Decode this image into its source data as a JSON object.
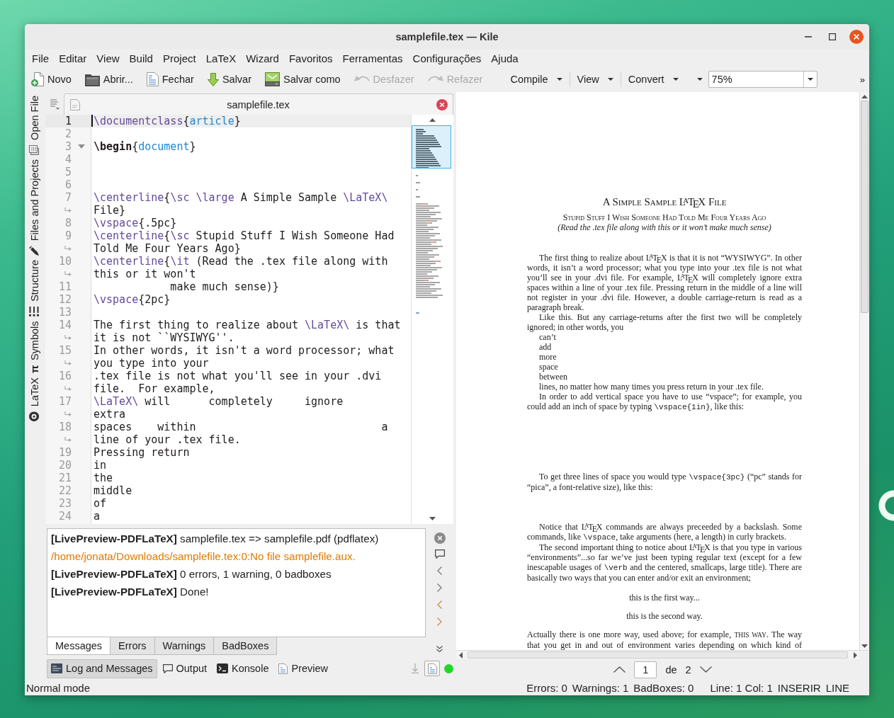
{
  "window": {
    "title": "samplefile.tex — Kile"
  },
  "menu": [
    "File",
    "Editar",
    "View",
    "Build",
    "Project",
    "LaTeX",
    "Wizard",
    "Favoritos",
    "Ferramentas",
    "Configurações",
    "Ajuda"
  ],
  "toolbar": {
    "items": [
      {
        "kind": "button",
        "label": "Novo",
        "disabled": false
      },
      {
        "kind": "button",
        "label": "Abrir...",
        "disabled": false
      },
      {
        "kind": "button",
        "label": "Fechar",
        "disabled": false
      },
      {
        "kind": "button",
        "label": "Salvar",
        "disabled": false
      },
      {
        "kind": "button",
        "label": "Salvar como",
        "disabled": false
      },
      {
        "kind": "button",
        "label": "Desfazer",
        "disabled": true
      },
      {
        "kind": "button",
        "label": "Refazer",
        "disabled": true
      },
      {
        "kind": "dropdown",
        "label": "Compile"
      },
      {
        "kind": "dropdown",
        "label": "View"
      },
      {
        "kind": "dropdown",
        "label": "Convert"
      },
      {
        "kind": "dropdown"
      },
      {
        "kind": "combo",
        "value": "75%"
      }
    ],
    "overflow": "»"
  },
  "sidebar": {
    "tabs": [
      {
        "label": "Open File",
        "selected": false
      },
      {
        "label": "Files and Projects",
        "selected": false
      },
      {
        "label": "Structure",
        "selected": false
      },
      {
        "label": "Symbols",
        "glyph": "π",
        "selected": false
      },
      {
        "label": "LaTeX",
        "selected": false
      }
    ]
  },
  "editor": {
    "tab": {
      "title": "samplefile.tex"
    },
    "lines": [
      {
        "number": "1",
        "current": true,
        "fold": false,
        "rows": [
          [
            {
              "kind": "command",
              "text": "\\documentclass"
            },
            {
              "kind": "plain",
              "text": "{"
            },
            {
              "kind": "argument",
              "text": "article"
            },
            {
              "kind": "plain",
              "text": "}"
            }
          ]
        ]
      },
      {
        "number": "2",
        "current": false,
        "fold": false,
        "rows": [
          []
        ]
      },
      {
        "number": "3",
        "current": false,
        "fold": true,
        "rows": [
          [
            {
              "kind": "begin",
              "text": "\\begin"
            },
            {
              "kind": "plain",
              "text": "{"
            },
            {
              "kind": "argument",
              "text": "document"
            },
            {
              "kind": "plain",
              "text": "}"
            }
          ]
        ]
      },
      {
        "number": "4",
        "current": false,
        "fold": false,
        "rows": [
          []
        ]
      },
      {
        "number": "5",
        "current": false,
        "fold": false,
        "rows": [
          []
        ]
      },
      {
        "number": "6",
        "current": false,
        "fold": false,
        "rows": [
          []
        ]
      },
      {
        "number": "7",
        "current": false,
        "fold": false,
        "rows": [
          [
            {
              "kind": "command",
              "text": "\\centerline"
            },
            {
              "kind": "plain",
              "text": "{"
            },
            {
              "kind": "command",
              "text": "\\sc \\large"
            },
            {
              "kind": "plain",
              "text": " A Simple Sample "
            },
            {
              "kind": "command",
              "text": "\\LaTeX\\"
            }
          ],
          [
            {
              "kind": "plain",
              "text": "File}"
            }
          ]
        ]
      },
      {
        "number": "8",
        "current": false,
        "fold": false,
        "rows": [
          [
            {
              "kind": "command",
              "text": "\\vspace"
            },
            {
              "kind": "plain",
              "text": "{.5pc}"
            }
          ]
        ]
      },
      {
        "number": "9",
        "current": false,
        "fold": false,
        "rows": [
          [
            {
              "kind": "command",
              "text": "\\centerline"
            },
            {
              "kind": "plain",
              "text": "{"
            },
            {
              "kind": "command",
              "text": "\\sc"
            },
            {
              "kind": "plain",
              "text": " Stupid Stuff I Wish Someone Had"
            }
          ],
          [
            {
              "kind": "plain",
              "text": "Told Me Four Years Ago}"
            }
          ]
        ]
      },
      {
        "number": "10",
        "current": false,
        "fold": false,
        "rows": [
          [
            {
              "kind": "command",
              "text": "\\centerline"
            },
            {
              "kind": "plain",
              "text": "{"
            },
            {
              "kind": "command",
              "text": "\\it"
            },
            {
              "kind": "plain",
              "text": " (Read the .tex file along with"
            }
          ],
          [
            {
              "kind": "plain",
              "text": "this or it won't"
            }
          ]
        ]
      },
      {
        "number": "11",
        "current": false,
        "fold": false,
        "rows": [
          [
            {
              "kind": "plain",
              "text": "            make much sense)}"
            }
          ]
        ]
      },
      {
        "number": "12",
        "current": false,
        "fold": false,
        "rows": [
          [
            {
              "kind": "command",
              "text": "\\vspace"
            },
            {
              "kind": "plain",
              "text": "{2pc}"
            }
          ]
        ]
      },
      {
        "number": "13",
        "current": false,
        "fold": false,
        "rows": [
          []
        ]
      },
      {
        "number": "14",
        "current": false,
        "fold": false,
        "rows": [
          [
            {
              "kind": "plain",
              "text": "The first thing to realize about "
            },
            {
              "kind": "command",
              "text": "\\LaTeX\\"
            },
            {
              "kind": "plain",
              "text": " is that"
            }
          ],
          [
            {
              "kind": "plain",
              "text": "it is not ``WYSIWYG''."
            }
          ]
        ]
      },
      {
        "number": "15",
        "current": false,
        "fold": false,
        "rows": [
          [
            {
              "kind": "plain",
              "text": "In other words, it isn't a word processor; what"
            }
          ],
          [
            {
              "kind": "plain",
              "text": "you type into your"
            }
          ]
        ]
      },
      {
        "number": "16",
        "current": false,
        "fold": false,
        "rows": [
          [
            {
              "kind": "plain",
              "text": ".tex file is not what you'll see in your .dvi"
            }
          ],
          [
            {
              "kind": "plain",
              "text": "file.  For example,"
            }
          ]
        ]
      },
      {
        "number": "17",
        "current": false,
        "fold": false,
        "rows": [
          [
            {
              "kind": "command",
              "text": "\\LaTeX\\"
            },
            {
              "kind": "plain",
              "text": " will      completely     ignore"
            }
          ],
          [
            {
              "kind": "plain",
              "text": "extra"
            }
          ]
        ]
      },
      {
        "number": "18",
        "current": false,
        "fold": false,
        "rows": [
          [
            {
              "kind": "plain",
              "text": "spaces    within                             a"
            }
          ],
          [
            {
              "kind": "plain",
              "text": "line of your .tex file."
            }
          ]
        ]
      },
      {
        "number": "19",
        "current": false,
        "fold": false,
        "rows": [
          [
            {
              "kind": "plain",
              "text": "Pressing return"
            }
          ]
        ]
      },
      {
        "number": "20",
        "current": false,
        "fold": false,
        "rows": [
          [
            {
              "kind": "plain",
              "text": "in"
            }
          ]
        ]
      },
      {
        "number": "21",
        "current": false,
        "fold": false,
        "rows": [
          [
            {
              "kind": "plain",
              "text": "the"
            }
          ]
        ]
      },
      {
        "number": "22",
        "current": false,
        "fold": false,
        "rows": [
          [
            {
              "kind": "plain",
              "text": "middle"
            }
          ]
        ]
      },
      {
        "number": "23",
        "current": false,
        "fold": false,
        "rows": [
          [
            {
              "kind": "plain",
              "text": "of"
            }
          ]
        ]
      },
      {
        "number": "24",
        "current": false,
        "fold": false,
        "rows": [
          [
            {
              "kind": "plain",
              "text": "a"
            }
          ]
        ]
      }
    ]
  },
  "messages_panel": {
    "messages": [
      {
        "kind": "info",
        "text": "**[LivePreview-PDFLaTeX]** samplefile.tex => samplefile.pdf (pdflatex)"
      },
      {
        "kind": "warning",
        "text": "/home/jonata/Downloads/samplefile.tex:0:No file samplefile.aux."
      },
      {
        "kind": "info",
        "text": "**[LivePreview-PDFLaTeX]** 0 errors, 1 warning, 0 badboxes"
      },
      {
        "kind": "info",
        "text": "**[LivePreview-PDFLaTeX]** Done!"
      }
    ],
    "tabs": [
      {
        "label": "Messages",
        "selected": true
      },
      {
        "label": "Errors",
        "selected": false
      },
      {
        "label": "Warnings",
        "selected": false
      },
      {
        "label": "BadBoxes",
        "selected": false
      }
    ]
  },
  "tool_views": [
    {
      "label": "Log and Messages",
      "selected": true
    },
    {
      "label": "Output",
      "selected": false
    },
    {
      "label": "Konsole",
      "selected": false
    },
    {
      "label": "Preview",
      "selected": false
    }
  ],
  "pdf_viewer": {
    "blocks": [
      {
        "kind": "title",
        "text": "A Simple Sample L$^{A}$T$_{E}$X File"
      },
      {
        "kind": "subtitle",
        "text": "Stupid Stuff I Wish Someone Had Told Me Four Years Ago"
      },
      {
        "kind": "note",
        "text": "(Read the .tex file along with this or it won’t make much sense)"
      },
      {
        "kind": "paragraph",
        "text": "The first thing to realize about L$^{A}$T$_{E}$X is that it is not “WYSIWYG”. In other words, it isn’t a word processor; what you type into your .tex file is not what you’ll see in your .dvi file. For example, L$^{A}$T$_{E}$X will completely ignore extra spaces within a line of your .tex file. Pressing return in the middle of a line will not register in your .dvi file. However, a double carriage-return is read as a paragraph break."
      },
      {
        "kind": "paragraph",
        "text": "Like this. But any carriage-returns after the first two will be completely ignored; in other words, you"
      },
      {
        "kind": "line",
        "text": "can’t"
      },
      {
        "kind": "line",
        "text": "add"
      },
      {
        "kind": "line",
        "text": "more"
      },
      {
        "kind": "line",
        "text": "space"
      },
      {
        "kind": "line",
        "text": "between"
      },
      {
        "kind": "line",
        "text": "lines, no matter how many times you press return in your .tex file."
      },
      {
        "kind": "paragraph",
        "segments": [
          {
            "kind": "text",
            "text": "In order to add vertical space you have to use “vspace”; for example, you could add an inch of space by typing "
          },
          {
            "kind": "code",
            "text": "\\vspace{1in}"
          },
          {
            "kind": "text",
            "text": ", like this:"
          }
        ]
      },
      {
        "kind": "paragraph",
        "segments": [
          {
            "kind": "text",
            "text": "To get three lines of space you would type "
          },
          {
            "kind": "code",
            "text": "\\vspace{3pc}"
          },
          {
            "kind": "text",
            "text": " (“pc” stands for “pica”, a font-relative size), like this:"
          }
        ]
      },
      {
        "kind": "paragraph",
        "segments": [
          {
            "kind": "text",
            "text": "Notice that L$^{A}$T$_{E}$X commands are always preceeded by a backslash. Some commands, like "
          },
          {
            "kind": "code",
            "text": "\\vspace"
          },
          {
            "kind": "text",
            "text": ", take arguments (here, a length) in curly brackets."
          }
        ]
      },
      {
        "kind": "paragraph",
        "segments": [
          {
            "kind": "text",
            "text": "The second important thing to notice about L$^{A}$T$_{E}$X is that you type in various “environments”...so far we’ve just been typing regular text (except for a few inescapable usages of "
          },
          {
            "kind": "code",
            "text": "\\verb"
          },
          {
            "kind": "text",
            "text": " and the centered, smallcaps, large title). There are basically two ways that you can enter and/or exit an environment;"
          }
        ]
      },
      {
        "kind": "centered",
        "text": "this is the first way..."
      },
      {
        "kind": "centered",
        "text": "this is the second way."
      },
      {
        "kind": "continued",
        "segments": [
          {
            "kind": "text",
            "text": "Actually there is one more way, used above; for example, "
          },
          {
            "kind": "smallcaps",
            "text": "THIS WAY"
          },
          {
            "kind": "text",
            "text": ". The way that you get in and out of environment varies depending on which kind of"
          }
        ]
      }
    ],
    "page_navigation": {
      "page": "1",
      "separator": "de",
      "total": "2"
    }
  },
  "status_bar": {
    "mode": "Normal mode",
    "build_summary": [
      "Errors: 0",
      "Warnings: 1",
      "BadBoxes: 0"
    ],
    "cursor_info": [
      "Line: 1 Col: 1",
      "INSERIR",
      "LINE"
    ]
  }
}
